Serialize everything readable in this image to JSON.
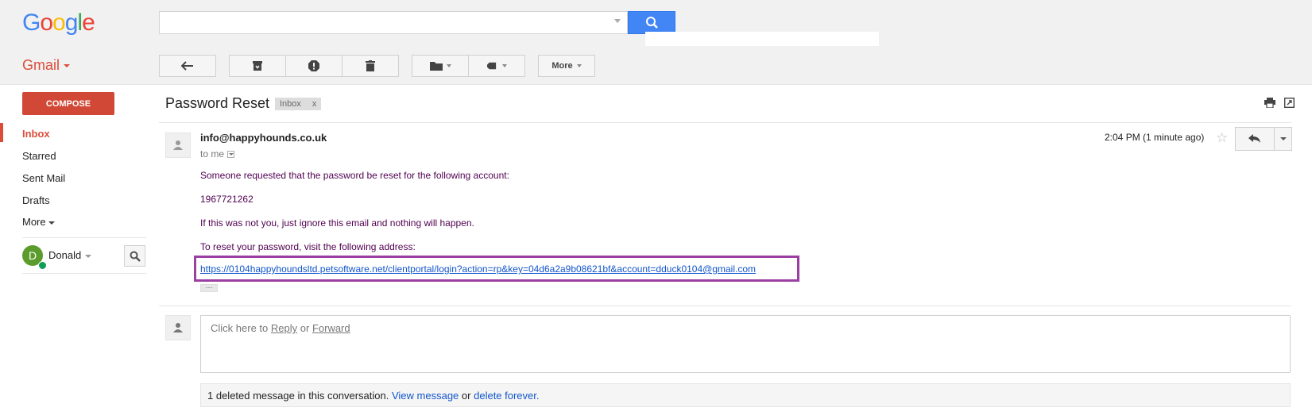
{
  "header": {
    "logo_letters": [
      {
        "char": "G",
        "color": "#4285f4"
      },
      {
        "char": "o",
        "color": "#ea4335"
      },
      {
        "char": "o",
        "color": "#fbbc05"
      },
      {
        "char": "g",
        "color": "#4285f4"
      },
      {
        "char": "l",
        "color": "#34a853"
      },
      {
        "char": "e",
        "color": "#ea4335"
      }
    ],
    "search_value": "",
    "search_icon": "search-icon"
  },
  "app": {
    "label": "Gmail"
  },
  "toolbar": {
    "buttons": [
      "back-arrow-icon",
      "archive-icon",
      "report-spam-icon",
      "delete-icon",
      "folder-icon",
      "label-icon"
    ],
    "more_label": "More"
  },
  "nav": {
    "compose_label": "COMPOSE",
    "items": [
      {
        "label": "Inbox",
        "active": true
      },
      {
        "label": "Starred"
      },
      {
        "label": "Sent Mail"
      },
      {
        "label": "Drafts"
      },
      {
        "label": "More"
      }
    ],
    "user": {
      "initial": "D",
      "name": "Donald"
    }
  },
  "message": {
    "subject": "Password Reset",
    "label": "Inbox",
    "label_remove": "x",
    "sender": "info@happyhounds.co.uk",
    "to": "to me",
    "timestamp": "2:04 PM (1 minute ago)",
    "body": [
      "Someone requested that the password be reset for the following account:",
      "1967721262",
      "If this was not you, just ignore this email and nothing will happen.",
      "To reset your password, visit the following address:"
    ],
    "reset_link": "https://0104happyhoundsltd.petsoftware.net/clientportal/login?action=rp&key=04d6a2a9b08621bf&account=dduck0104@gmail.com",
    "ellipsis": "···"
  },
  "reply": {
    "prefix": "Click here to",
    "reply_label": "Reply",
    "or": "or",
    "forward_label": "Forward"
  },
  "deleted": {
    "text": "1 deleted message in this conversation.",
    "view_label": "View message",
    "or": "or",
    "delete_label": "delete forever."
  },
  "colors": {
    "accent": "#dd4b39",
    "search_blue": "#4285f4",
    "link": "#1155cc",
    "highlight_box": "#9c3fa3"
  }
}
